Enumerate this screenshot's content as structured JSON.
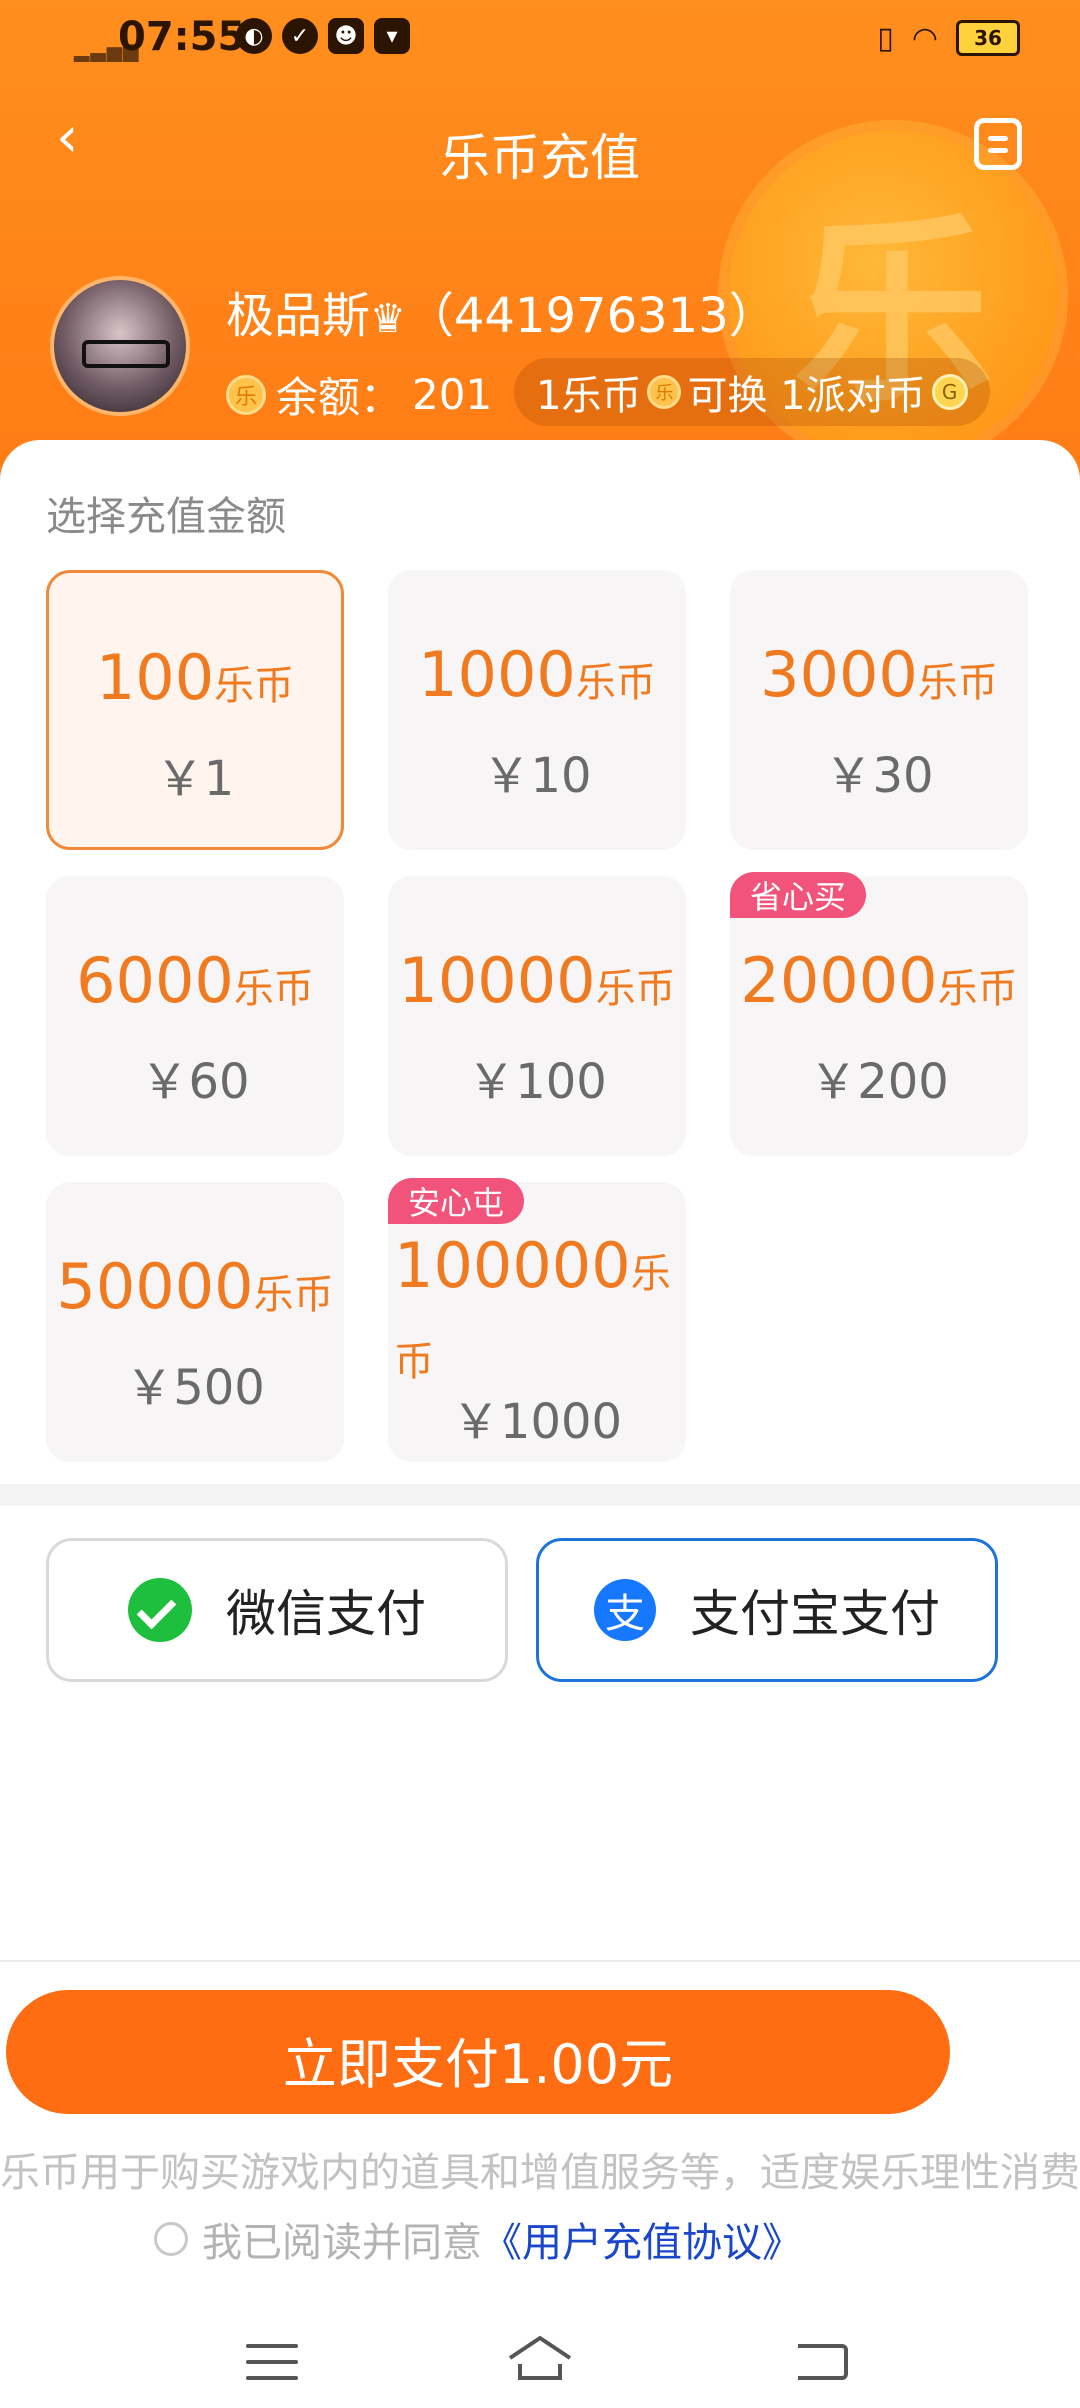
{
  "status_bar": {
    "time": "07:55",
    "battery": "36"
  },
  "header": {
    "title": "乐币充值",
    "coin_glyph": "乐"
  },
  "user": {
    "name": "极品斯",
    "crown": "♛",
    "id_text": "（441976313）",
    "balance_label": "余额：",
    "balance_value": "201",
    "coin_symbol": "乐",
    "exchange_prefix": "1乐币",
    "exchange_mid": "可换 1派对币",
    "party_coin_symbol": "G"
  },
  "section_label": "选择充值金额",
  "unit_label": "乐币",
  "amounts": [
    {
      "coins": "100",
      "price": "￥1",
      "selected": true
    },
    {
      "coins": "1000",
      "price": "￥10"
    },
    {
      "coins": "3000",
      "price": "￥30"
    },
    {
      "coins": "6000",
      "price": "￥60"
    },
    {
      "coins": "10000",
      "price": "￥100"
    },
    {
      "coins": "20000",
      "price": "￥200",
      "tag": "省心买"
    },
    {
      "coins": "50000",
      "price": "￥500"
    },
    {
      "coins": "100000",
      "price": "￥1000",
      "tag": "安心屯"
    }
  ],
  "payment": {
    "wechat_label": "微信支付",
    "alipay_label": "支付宝支付",
    "alipay_glyph": "支",
    "selected": "alipay"
  },
  "confirm_label": "立即支付1.00元",
  "notice": "乐币用于购买游戏内的道具和增值服务等，适度娱乐理性消费",
  "agreement": {
    "prefix": "我已阅读并同意",
    "link": "《用户充值协议》"
  },
  "colors": {
    "brand_orange": "#ff7a14",
    "accent_amount": "#f07a1f",
    "tag_pink": "#f2537a",
    "alipay_blue": "#1e73d9",
    "link_blue": "#1a47c9"
  }
}
